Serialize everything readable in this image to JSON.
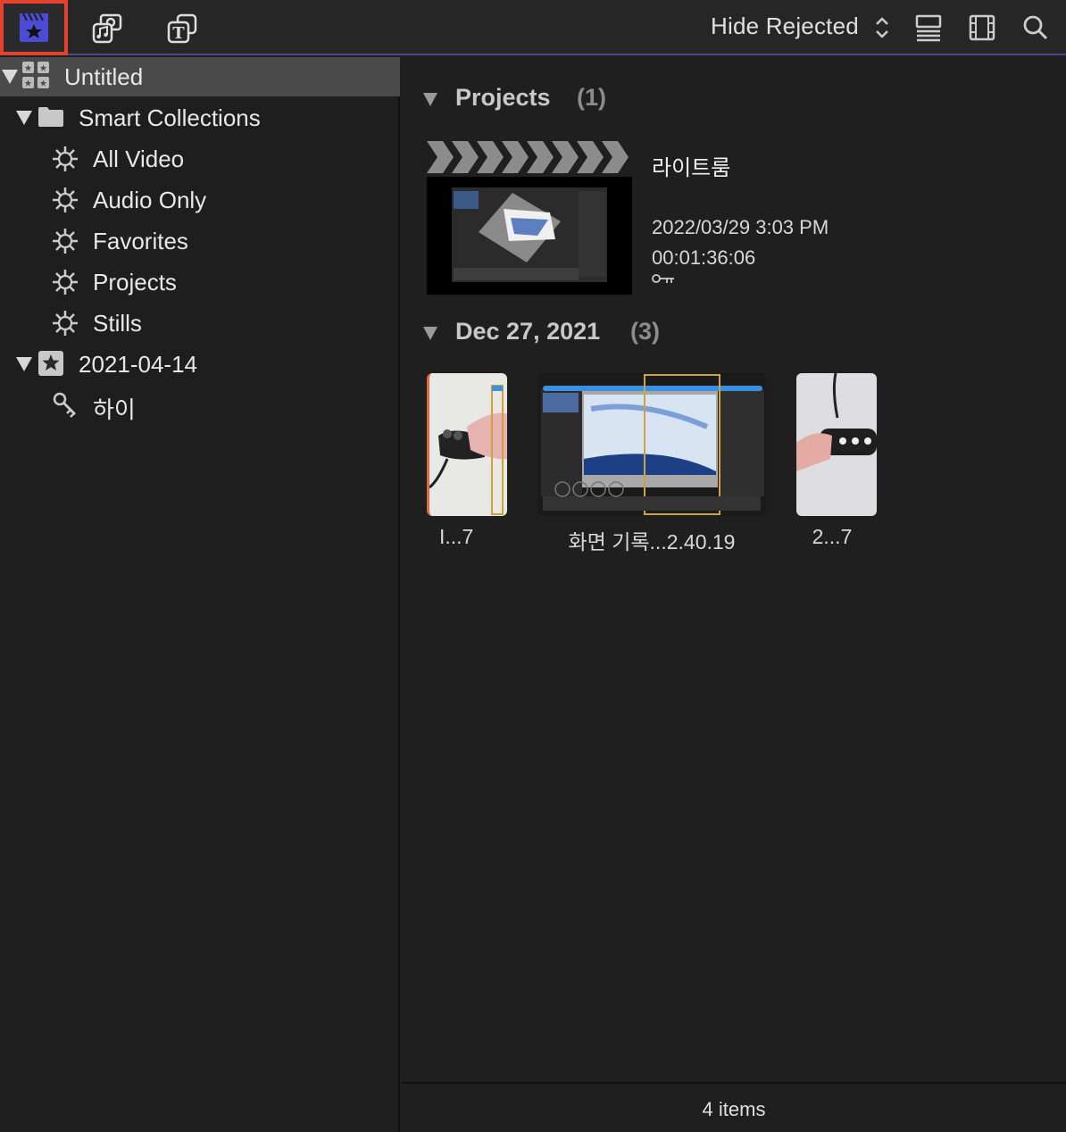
{
  "toolbar": {
    "active_tab": "photos-and-media-library",
    "filter_label": "Hide Rejected",
    "accent_color": "#e5412f"
  },
  "sidebar": {
    "library": "Untitled",
    "smart_collections": "Smart Collections",
    "collections": [
      "All Video",
      "Audio Only",
      "Favorites",
      "Projects",
      "Stills"
    ],
    "event": "2021-04-14",
    "keyword": "하이"
  },
  "main": {
    "projects_section": {
      "title": "Projects",
      "count": "(1)"
    },
    "project": {
      "name": "라이트룸",
      "date": "2022/03/29 3:03 PM",
      "duration": "00:01:36:06"
    },
    "date_section": {
      "title": "Dec 27, 2021",
      "count": "(3)"
    },
    "clips": [
      {
        "label": "I...7"
      },
      {
        "label": "화면 기록...2.40.19"
      },
      {
        "label": "2...7"
      }
    ]
  },
  "footer": {
    "items": "4 items"
  }
}
